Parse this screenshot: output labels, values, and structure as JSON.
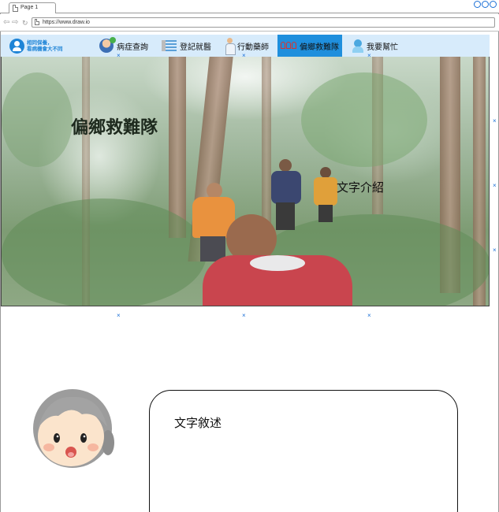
{
  "browser": {
    "tab_label": "Page 1",
    "url": "https://www.draw.io"
  },
  "logo": {
    "line1": "相同保養，",
    "line2": "看病機會大不同"
  },
  "menu": {
    "items": [
      {
        "label": "病症查詢",
        "icon": "doctor-icon",
        "active": false
      },
      {
        "label": "登記就醫",
        "icon": "list-icon",
        "active": false
      },
      {
        "label": "行動藥師",
        "icon": "pharmacist-icon",
        "active": false
      },
      {
        "label": "偏鄉救難隊",
        "icon": "team-icon",
        "active": true
      },
      {
        "label": "我要幫忙",
        "icon": "helper-icon",
        "active": false
      }
    ]
  },
  "hero": {
    "title": "偏鄉救難隊",
    "description": "文字介紹"
  },
  "card": {
    "text": "文字敘述"
  },
  "colors": {
    "menu_bg": "#d7ebfb",
    "active_bg": "#1f8fdd",
    "logo_blue": "#1e84d6",
    "marker_blue": "#1a6fd6"
  }
}
